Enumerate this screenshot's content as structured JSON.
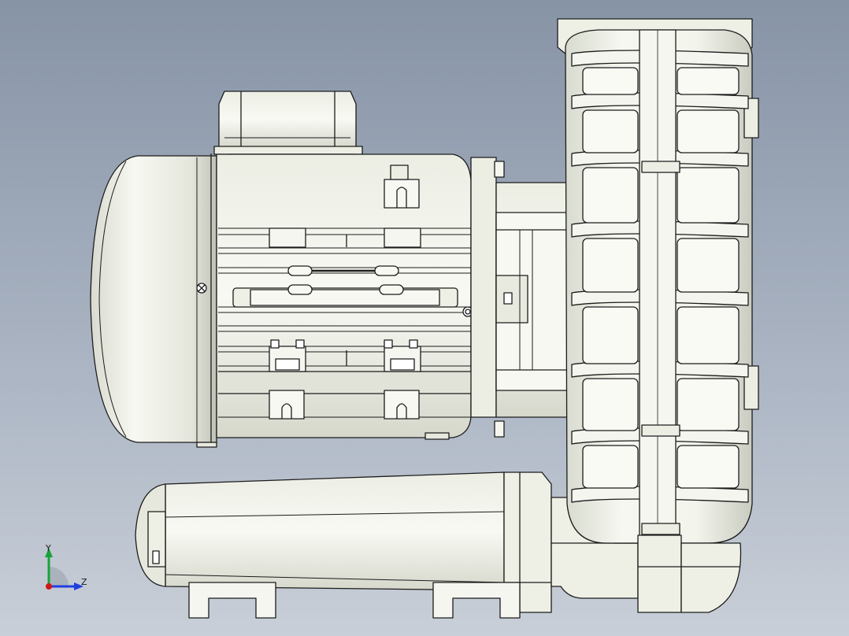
{
  "viewport": {
    "background_top": "#8794a6",
    "background_bottom": "#c9cfd8"
  },
  "model": {
    "description_icon": "side-channel-blower-motor-model",
    "line_color": "#1c1c1c",
    "face_color": "#f2f3ea",
    "shade_color": "#c9ccc0"
  },
  "triad": {
    "y_label": "Y",
    "z_label": "Z",
    "y_color": "#18a33a",
    "z_color": "#1f3fe0",
    "x_color": "#d01818"
  }
}
